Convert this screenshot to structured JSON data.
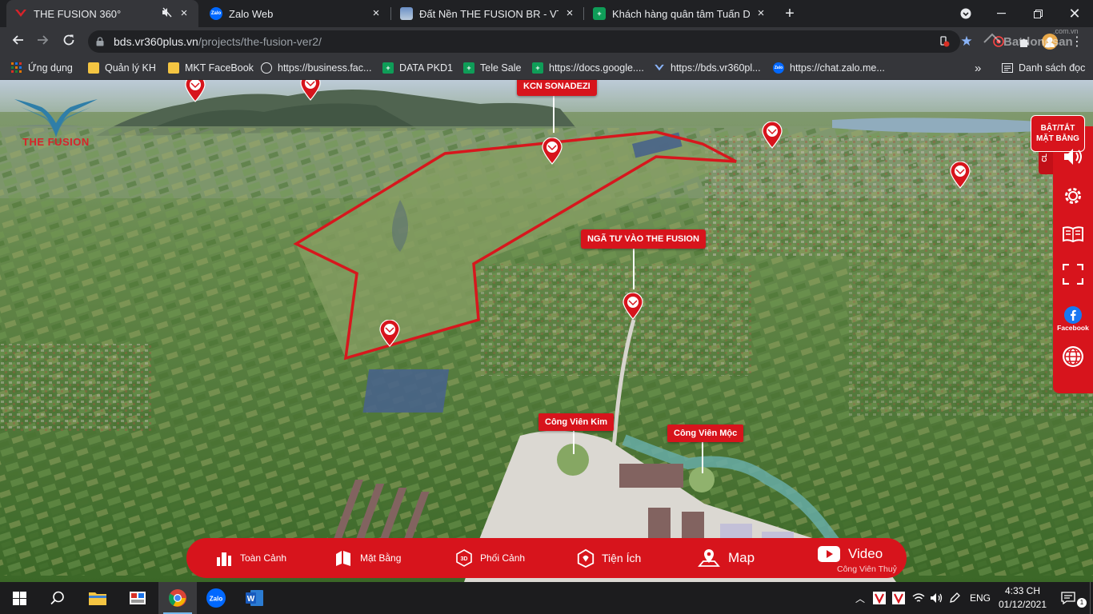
{
  "browser": {
    "tabs": [
      {
        "title": "THE FUSION 360°",
        "active": true
      },
      {
        "title": "Zalo Web",
        "active": false
      },
      {
        "title": "Đất Nền THE FUSION BR - VT Đất",
        "active": false
      },
      {
        "title": "Khách hàng quân tâm Tuấn Dươ",
        "active": false
      }
    ],
    "url_host": "bds.vr360plus.vn",
    "url_path": "/projects/the-fusion-ver2/",
    "bookmarks": [
      "Ứng dụng",
      "Quản lý KH",
      "MKT FaceBook",
      "https://business.fac...",
      "DATA PKD1",
      "Tele Sale",
      "https://docs.google....",
      "https://bds.vr360pl...",
      "https://chat.zalo.me..."
    ],
    "reading_list": "Danh sách đọc",
    "profile_watermark": "Batdongsan",
    "profile_watermark_sub": ".com.vn"
  },
  "page": {
    "logo_text": "THE FUSION",
    "toggle_label_line1": "BẬT/TẮT",
    "toggle_label_line2": "MẶT BẰNG",
    "side_tab_text": "CL",
    "facebook_label": "Facebook",
    "labels": {
      "kcn": "KCN SONADEZI",
      "nga_tu": "NGÃ TƯ VÀO THE FUSION",
      "park_kim": "Công Viên Kim",
      "park_moc": "Công Viên Mộc",
      "park_thuy": "Công Viên Thuỷ"
    },
    "menu": [
      {
        "label": "Toàn Cảnh",
        "icon": "panorama-icon"
      },
      {
        "label": "Mặt Bằng",
        "icon": "floorplan-icon"
      },
      {
        "label": "Phối Cảnh",
        "icon": "3d-view-icon"
      },
      {
        "label": "Tiện Ích",
        "icon": "amenities-icon"
      },
      {
        "label": "Map",
        "icon": "map-icon"
      },
      {
        "label": "Video",
        "icon": "video-icon"
      }
    ],
    "map_watermark": "batdongsan.com.vn"
  },
  "taskbar": {
    "language": "ENG",
    "time": "4:33 CH",
    "date": "01/12/2021"
  },
  "colors": {
    "brand_red": "#d7141c",
    "chrome_dark": "#202124",
    "chrome_toolbar": "#35363a"
  }
}
